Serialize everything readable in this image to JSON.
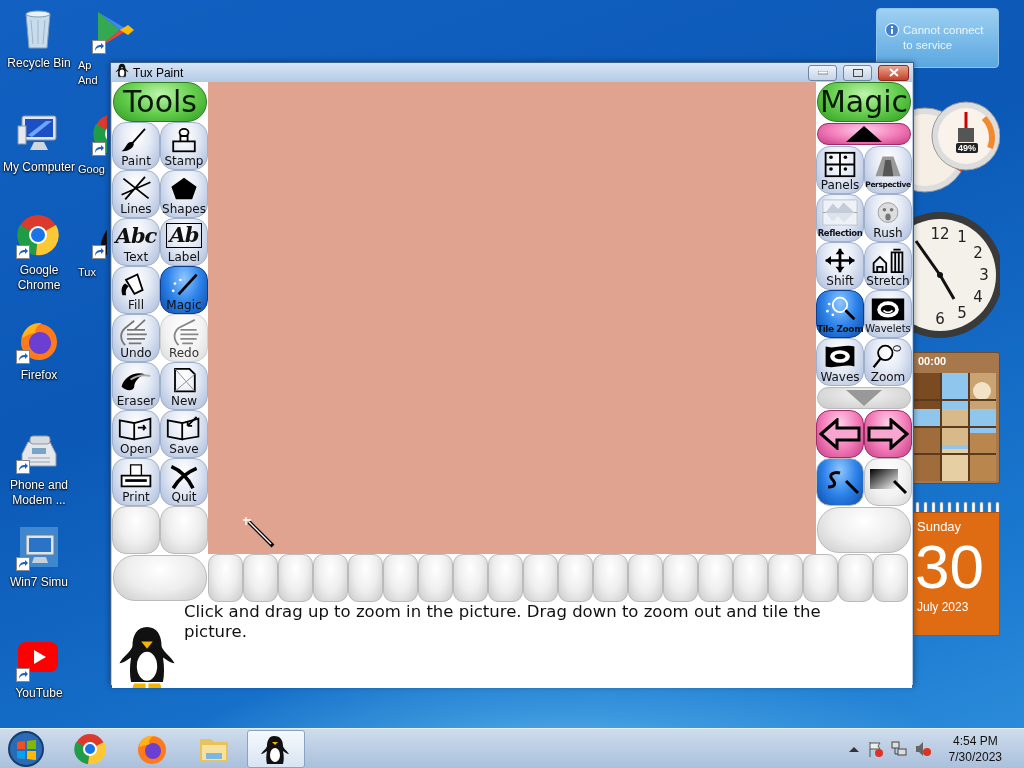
{
  "desktop_icons": [
    {
      "label": "Recycle Bin"
    },
    {
      "label": "My Computer"
    },
    {
      "label": "Google Chrome"
    },
    {
      "label": "Firefox"
    },
    {
      "label": "Phone and Modem ..."
    },
    {
      "label": "Win7 Simu"
    },
    {
      "label": "YouTube"
    }
  ],
  "desktop_icons_partial": [
    {
      "label": "Ap And"
    },
    {
      "label": "Goog"
    },
    {
      "label": "Tux"
    }
  ],
  "notification": {
    "text": "Cannot connect to service"
  },
  "gauge": {
    "reading": "49%"
  },
  "clock": {
    "numerals": [
      "12",
      "1",
      "2",
      "3",
      "4",
      "5",
      "6"
    ]
  },
  "puzzle": {
    "timer": "00:00"
  },
  "calendar": {
    "weekday": "Sunday",
    "day": "30",
    "month": "July 2023"
  },
  "window": {
    "title": "Tux Paint",
    "tools": {
      "title": "Tools",
      "items": [
        {
          "label": "Paint",
          "selected": false,
          "disabled": false
        },
        {
          "label": "Stamp",
          "selected": false,
          "disabled": false
        },
        {
          "label": "Lines",
          "selected": false,
          "disabled": false
        },
        {
          "label": "Shapes",
          "selected": false,
          "disabled": false
        },
        {
          "label": "Text",
          "glyph": "Abc",
          "selected": false,
          "disabled": false
        },
        {
          "label": "Label",
          "glyph": "Ab",
          "selected": false,
          "disabled": false
        },
        {
          "label": "Fill",
          "selected": false,
          "disabled": false
        },
        {
          "label": "Magic",
          "selected": true,
          "disabled": false
        },
        {
          "label": "Undo",
          "selected": false,
          "disabled": false
        },
        {
          "label": "Redo",
          "selected": false,
          "disabled": true
        },
        {
          "label": "Eraser",
          "selected": false,
          "disabled": false
        },
        {
          "label": "New",
          "selected": false,
          "disabled": false
        },
        {
          "label": "Open",
          "selected": false,
          "disabled": false
        },
        {
          "label": "Save",
          "selected": false,
          "disabled": false
        },
        {
          "label": "Print",
          "selected": false,
          "disabled": false
        },
        {
          "label": "Quit",
          "selected": false,
          "disabled": false
        }
      ]
    },
    "magic": {
      "title": "Magic",
      "items": [
        {
          "label": "Panels",
          "selected": false
        },
        {
          "label": "Perspective",
          "selected": false
        },
        {
          "label": "Reflection",
          "selected": false
        },
        {
          "label": "Rush",
          "selected": false
        },
        {
          "label": "Shift",
          "selected": false
        },
        {
          "label": "Stretch",
          "selected": false
        },
        {
          "label": "Tile Zoom",
          "selected": true
        },
        {
          "label": "Wavelets",
          "selected": false
        },
        {
          "label": "Waves",
          "selected": false
        },
        {
          "label": "Zoom",
          "selected": false
        }
      ],
      "modes": [
        {
          "selected": true
        },
        {
          "selected": false
        }
      ]
    },
    "message": "Click and drag up to zoom in the picture. Drag down to zoom out and tile the picture."
  },
  "taskbar": {
    "apps": [
      {
        "selected": false
      },
      {
        "selected": false
      },
      {
        "selected": false
      },
      {
        "selected": true
      }
    ],
    "time": "4:54 PM",
    "date": "7/30/2023"
  }
}
